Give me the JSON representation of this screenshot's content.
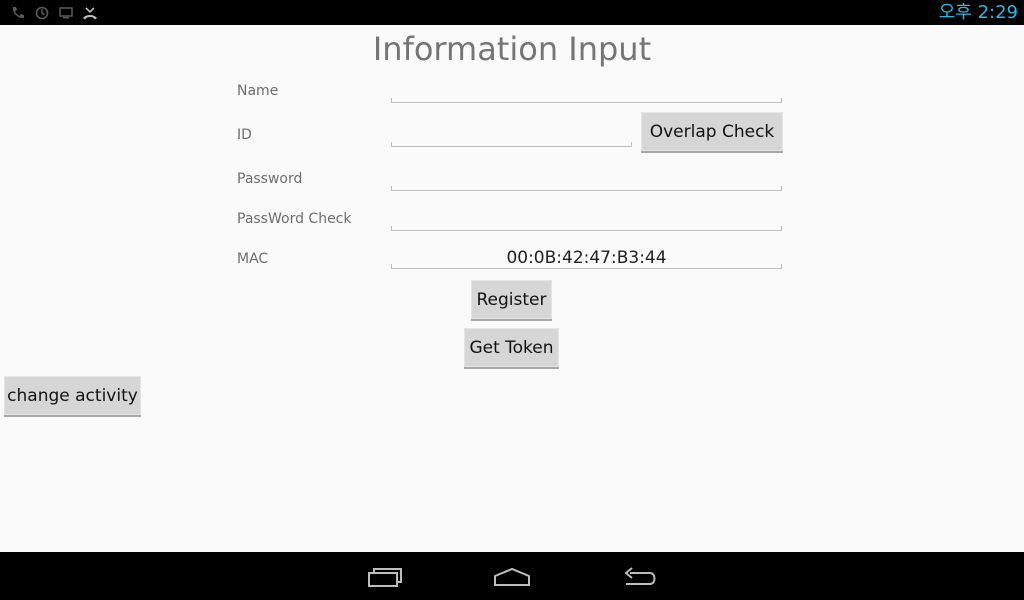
{
  "status_bar": {
    "time": "오후 2:29",
    "icons": [
      "phone-call-icon",
      "sync-icon",
      "cast-screen-icon",
      "missed-call-icon"
    ]
  },
  "title": "Information Input",
  "form": {
    "name_label": "Name",
    "name_value": "",
    "id_label": "ID",
    "id_value": "",
    "overlap_check_label": "Overlap Check",
    "password_label": "Password",
    "password_value": "",
    "password_check_label": "PassWord Check",
    "password_check_value": "",
    "mac_label": "MAC",
    "mac_value": "00:0B:42:47:B3:44",
    "register_label": "Register",
    "get_token_label": "Get Token"
  },
  "change_activity_label": "change activity",
  "nav_bar": {
    "icons": [
      "recent-apps-icon",
      "home-icon",
      "back-icon"
    ]
  },
  "colors": {
    "clock": "#33b5e5",
    "button_bg": "#d6d6d6",
    "background": "#fafafa"
  }
}
